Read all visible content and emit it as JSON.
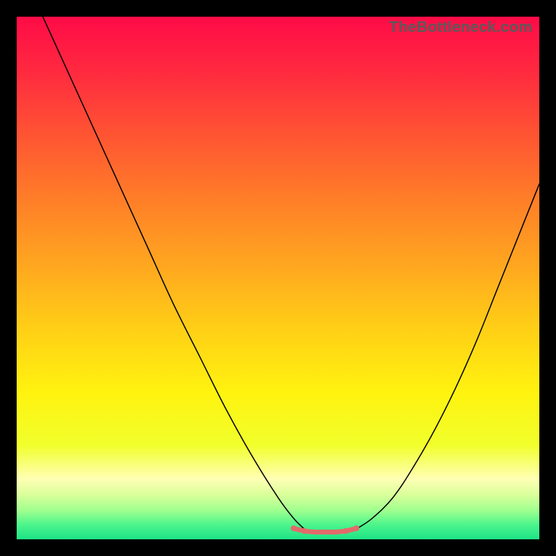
{
  "watermark": {
    "text": "TheBottleneck.com"
  },
  "gradient": {
    "stops": [
      {
        "offset": 0.0,
        "color": "#ff0b47"
      },
      {
        "offset": 0.1,
        "color": "#ff2840"
      },
      {
        "offset": 0.22,
        "color": "#ff5233"
      },
      {
        "offset": 0.35,
        "color": "#ff7e28"
      },
      {
        "offset": 0.48,
        "color": "#ffa81f"
      },
      {
        "offset": 0.6,
        "color": "#ffd016"
      },
      {
        "offset": 0.72,
        "color": "#fff30f"
      },
      {
        "offset": 0.82,
        "color": "#f1ff2c"
      },
      {
        "offset": 0.885,
        "color": "#ffffb5"
      },
      {
        "offset": 0.915,
        "color": "#d9ff9a"
      },
      {
        "offset": 0.945,
        "color": "#9fff8f"
      },
      {
        "offset": 0.972,
        "color": "#4cf58c"
      },
      {
        "offset": 1.0,
        "color": "#1de386"
      }
    ]
  },
  "chart_data": {
    "type": "line",
    "title": "",
    "xlabel": "",
    "ylabel": "",
    "x_range": [
      0,
      100
    ],
    "y_range": [
      0,
      100
    ],
    "series": [
      {
        "name": "left-curve",
        "x": [
          5,
          10,
          15,
          20,
          25,
          30,
          35,
          40,
          45,
          50,
          53,
          55
        ],
        "y": [
          100,
          89,
          78,
          67,
          56,
          45,
          35,
          25,
          16,
          8,
          4,
          2
        ],
        "stroke": "#000000",
        "width": 1.6
      },
      {
        "name": "right-curve",
        "x": [
          65,
          68,
          72,
          76,
          80,
          84,
          88,
          92,
          96,
          100
        ],
        "y": [
          2,
          4,
          8,
          14,
          21,
          29,
          38,
          48,
          58,
          68
        ],
        "stroke": "#000000",
        "width": 1.6
      },
      {
        "name": "bottom-band",
        "x": [
          53,
          55,
          57,
          59,
          61,
          63,
          65
        ],
        "y": [
          2.1,
          1.6,
          1.4,
          1.4,
          1.4,
          1.6,
          2.1
        ],
        "stroke": "#e36a6a",
        "width": 7
      }
    ],
    "markers": [
      {
        "x": 53,
        "y": 2.1,
        "r": 4.2,
        "color": "#e36a6a"
      },
      {
        "x": 55,
        "y": 1.6,
        "r": 4.2,
        "color": "#e36a6a"
      },
      {
        "x": 63,
        "y": 1.6,
        "r": 4.2,
        "color": "#e36a6a"
      },
      {
        "x": 65,
        "y": 2.1,
        "r": 4.2,
        "color": "#e36a6a"
      }
    ]
  }
}
